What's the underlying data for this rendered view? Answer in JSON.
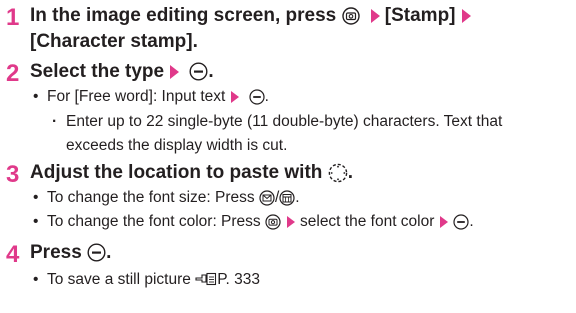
{
  "steps": [
    {
      "number": "1",
      "text_a": "In the image editing screen, press",
      "text_b": "[Stamp]",
      "text_c": "[Character stamp]."
    },
    {
      "number": "2",
      "text_a": "Select the type",
      "text_b": ".",
      "bullet": {
        "text_a": "For [Free word]: Input text",
        "sub": "Enter up to 22 single-byte (11 double-byte) characters. Text that exceeds the display width is cut."
      }
    },
    {
      "number": "3",
      "text_a": "Adjust the location to paste with",
      "text_b": ".",
      "bullets": [
        {
          "text_a": "To change the font size: Press",
          "sep": "/",
          "text_b": "."
        },
        {
          "text_a": "To change the font color: Press",
          "text_b": "select the font color",
          "text_c": "."
        }
      ]
    },
    {
      "number": "4",
      "text_a": "Press",
      "text_b": ".",
      "bullet": {
        "text_a": "To save a still picture",
        "ref": "P. 333"
      }
    }
  ],
  "colors": {
    "accent": "#e0398a",
    "text": "#231f20"
  },
  "icons": [
    "camera-key-icon",
    "arrow-right-icon",
    "center-key-icon",
    "multi-direction-key-icon",
    "mail-key-icon",
    "schedule-key-icon",
    "reference-icon"
  ]
}
